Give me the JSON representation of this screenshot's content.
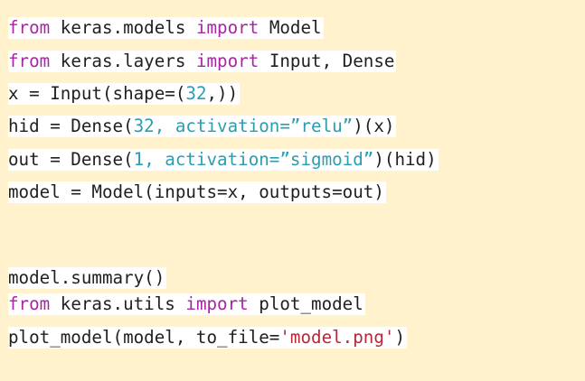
{
  "colors": {
    "background": "#fff2cc",
    "line_background": "#ffffff",
    "text": "#1f1f1f",
    "keyword": "#a626a4",
    "number": "#2a9db0",
    "string_double": "#2a9db0",
    "string_single": "#b5283a"
  },
  "lines": [
    {
      "tokens": [
        {
          "t": "from",
          "k": "kw"
        },
        {
          "t": " keras.models ",
          "k": "plain"
        },
        {
          "t": "import",
          "k": "kw"
        },
        {
          "t": " Model",
          "k": "plain"
        }
      ]
    },
    {
      "tokens": [
        {
          "t": "from",
          "k": "kw"
        },
        {
          "t": " keras.layers ",
          "k": "plain"
        },
        {
          "t": "import",
          "k": "kw"
        },
        {
          "t": " Input, Dense",
          "k": "plain"
        }
      ]
    },
    {
      "tokens": [
        {
          "t": "x = Input(shape=(",
          "k": "plain"
        },
        {
          "t": "32",
          "k": "num"
        },
        {
          "t": ",))",
          "k": "plain"
        }
      ]
    },
    {
      "tokens": [
        {
          "t": "hid = Dense(",
          "k": "plain"
        },
        {
          "t": "32",
          "k": "num"
        },
        {
          "t": ", activation=”relu”",
          "k": "str"
        },
        {
          "t": ")(x)",
          "k": "plain"
        }
      ]
    },
    {
      "tokens": [
        {
          "t": "out = Dense(",
          "k": "plain"
        },
        {
          "t": "1",
          "k": "num"
        },
        {
          "t": ", activation=”sigmoid”",
          "k": "str"
        },
        {
          "t": ")(hid)",
          "k": "plain"
        }
      ]
    },
    {
      "tokens": [
        {
          "t": "model = Model(inputs=x, outputs=out)",
          "k": "plain"
        }
      ]
    },
    {
      "tokens": [
        {
          "t": "model.summary()",
          "k": "plain"
        }
      ]
    },
    {
      "tokens": [
        {
          "t": "from",
          "k": "kw"
        },
        {
          "t": " keras.utils ",
          "k": "plain"
        },
        {
          "t": "import",
          "k": "kw"
        },
        {
          "t": " plot_model",
          "k": "plain"
        }
      ]
    },
    {
      "tokens": [
        {
          "t": "plot_model(model, to_file=",
          "k": "plain"
        },
        {
          "t": "'model.png'",
          "k": "sq"
        },
        {
          "t": ")",
          "k": "plain"
        }
      ]
    }
  ]
}
